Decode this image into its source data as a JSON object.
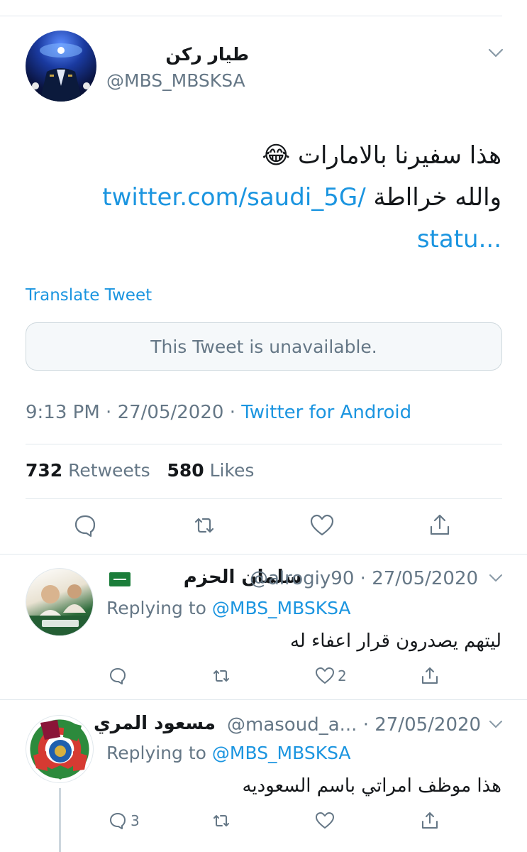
{
  "main_tweet": {
    "display_name": "طيار ركن",
    "handle": "@MBS_MBSKSA",
    "text_line1": "هذا سفيرنا بالامارات",
    "emoji": "😂",
    "text_line2_prefix": "والله خرااطة",
    "link_part1": "twitter.com/saudi_5G/",
    "link_part2": "statu...",
    "translate_label": "Translate Tweet",
    "unavailable_text": "This Tweet is unavailable.",
    "time": "9:13 PM",
    "date": "27/05/2020",
    "separator": "·",
    "source": "Twitter for Android",
    "retweets_count": "732",
    "retweets_label": "Retweets",
    "likes_count": "580",
    "likes_label": "Likes"
  },
  "replies": [
    {
      "display_name": "سلمان الحزم",
      "handle": "@alrogiy90",
      "date": "27/05/2020",
      "replying_prefix": "Replying to",
      "replying_to": "@MBS_MBSKSA",
      "text": "ليتهم يصدرون قرار اعفاء له",
      "reply_count": "",
      "like_count": "2"
    },
    {
      "display_name": "مسعود المري",
      "handle": "@masoud_a...",
      "date": "27/05/2020",
      "replying_prefix": "Replying to",
      "replying_to": "@MBS_MBSKSA",
      "text": "هذا موظف امراتي باسم السعوديه",
      "reply_count": "3",
      "like_count": ""
    }
  ],
  "colors": {
    "link": "#1b95e0",
    "muted": "#657786",
    "divider": "#e1e8ed"
  }
}
